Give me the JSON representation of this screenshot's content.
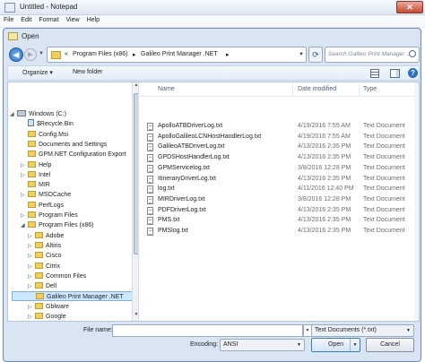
{
  "notepad": {
    "title": "Untitled - Notepad",
    "close_label": "✕",
    "menu": [
      "File",
      "Edit",
      "Format",
      "View",
      "Help"
    ]
  },
  "dialog": {
    "title": "Open",
    "breadcrumb": [
      "«",
      "Program Files (x86)",
      "▸",
      "Galileo Print Manager .NET",
      "▸"
    ],
    "search_placeholder": "Search Galileo Print Manager ...",
    "toolbar": {
      "organize": "Organize ▾",
      "new_folder": "New folder"
    },
    "nav_items": [
      {
        "label": "Windows (C:)",
        "kind": "drive",
        "expander": "◢"
      },
      {
        "label": "$Recycle.Bin",
        "kind": "bin",
        "expander": ""
      },
      {
        "label": "Config.Msi",
        "kind": "folder",
        "expander": ""
      },
      {
        "label": "Documents and Settings",
        "kind": "folder",
        "expander": ""
      },
      {
        "label": "GPM.NET Configuration Export",
        "kind": "folder",
        "expander": ""
      },
      {
        "label": "Help",
        "kind": "folder",
        "expander": "▷"
      },
      {
        "label": "Intel",
        "kind": "folder",
        "expander": "▷"
      },
      {
        "label": "MIR",
        "kind": "folder",
        "expander": ""
      },
      {
        "label": "MSOCache",
        "kind": "folder",
        "expander": "▷"
      },
      {
        "label": "PerfLogs",
        "kind": "folder",
        "expander": ""
      },
      {
        "label": "Program Files",
        "kind": "folder",
        "expander": "▷"
      },
      {
        "label": "Program Files (x86)",
        "kind": "folder",
        "expander": "◢"
      },
      {
        "label": "Adobe",
        "kind": "folder",
        "expander": "▷"
      },
      {
        "label": "Altiris",
        "kind": "folder",
        "expander": "▷"
      },
      {
        "label": "Cisco",
        "kind": "folder",
        "expander": "▷"
      },
      {
        "label": "Citrix",
        "kind": "folder",
        "expander": "▷"
      },
      {
        "label": "Common Files",
        "kind": "folder",
        "expander": "▷"
      },
      {
        "label": "Dell",
        "kind": "folder",
        "expander": "▷"
      },
      {
        "label": "Galileo Print Manager .NET",
        "kind": "folder",
        "expander": "",
        "selected": true
      },
      {
        "label": "Gblware",
        "kind": "folder",
        "expander": "▷"
      },
      {
        "label": "Google",
        "kind": "folder",
        "expander": "▷"
      }
    ],
    "columns": {
      "name": "Name",
      "date": "Date modified",
      "type": "Type"
    },
    "files": [
      {
        "name": "ApolloATBDriverLog.txt",
        "date": "4/19/2016 7:55 AM",
        "type": "Text Document"
      },
      {
        "name": "ApolloGalileoLCNHostHandlerLog.txt",
        "date": "4/19/2016 7:55 AM",
        "type": "Text Document"
      },
      {
        "name": "GalileoATBDriverLog.txt",
        "date": "4/13/2016 2:35 PM",
        "type": "Text Document"
      },
      {
        "name": "GPDSHostHandlerLog.txt",
        "date": "4/13/2016 2:35 PM",
        "type": "Text Document"
      },
      {
        "name": "GPMServicelog.txt",
        "date": "3/8/2016 12:28 PM",
        "type": "Text Document"
      },
      {
        "name": "ItineraryDriverLog.txt",
        "date": "4/13/2016 2:35 PM",
        "type": "Text Document"
      },
      {
        "name": "log.txt",
        "date": "4/11/2016 12:40 PM",
        "type": "Text Document"
      },
      {
        "name": "MIRDriverLog.txt",
        "date": "3/8/2016 12:28 PM",
        "type": "Text Document"
      },
      {
        "name": "PDFDriverLog.txt",
        "date": "4/13/2016 2:35 PM",
        "type": "Text Document"
      },
      {
        "name": "PMS.txt",
        "date": "4/13/2016 2:35 PM",
        "type": "Text Document"
      },
      {
        "name": "PMSlog.txt",
        "date": "4/13/2016 2:35 PM",
        "type": "Text Document"
      }
    ],
    "bottom": {
      "filename_label": "File name:",
      "filename_value": "",
      "filter_value": "Text Documents (*.txt)",
      "encoding_label": "Encoding:",
      "encoding_value": "ANSI",
      "open_label": "Open",
      "cancel_label": "Cancel"
    }
  }
}
